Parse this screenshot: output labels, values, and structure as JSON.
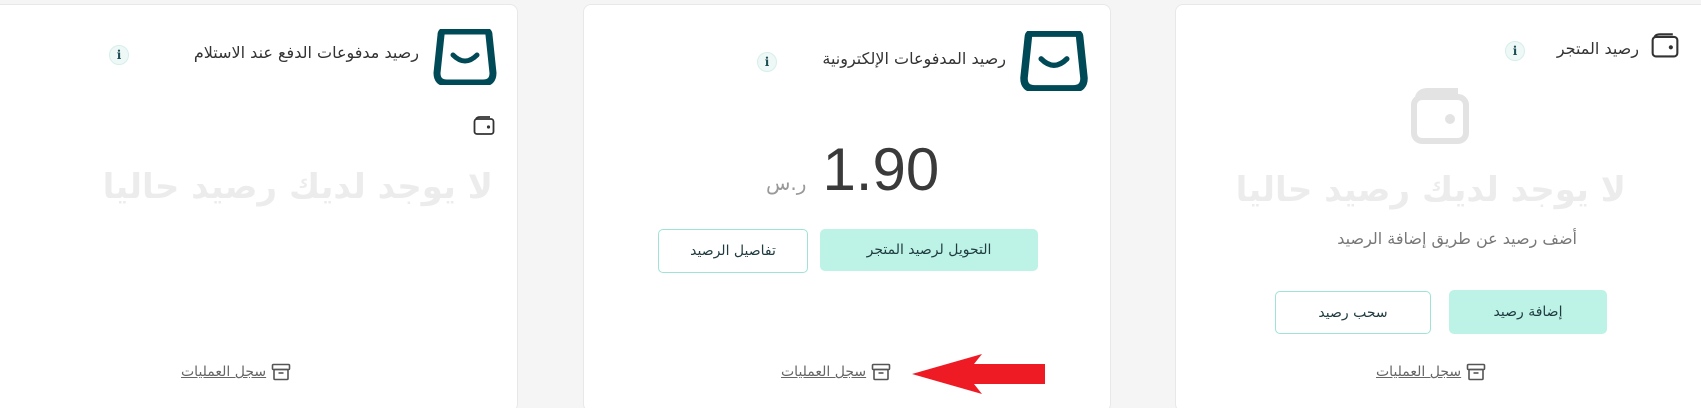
{
  "cards": {
    "cod": {
      "title": "رصيد مدفوعات الدفع عند الاستلام",
      "info": "i",
      "empty": "لا يوجد لديك رصيد حاليا",
      "log": "سجل العمليات"
    },
    "epay": {
      "title": "رصيد المدفوعات الإلكترونية",
      "info": "i",
      "amount": "1.90",
      "currency": "ر.س",
      "transfer_button": "التحويل لرصيد المتجر",
      "details_button": "تفاصيل الرصيد",
      "log": "سجل العمليات"
    },
    "store": {
      "title": "رصيد المتجر",
      "info": "i",
      "empty": "لا يوجد لديك رصيد حاليا",
      "hint": "أضف رصيد عن طريق إضافة الرصيد",
      "add_button": "إضافة رصيد",
      "withdraw_button": "سحب رصيد",
      "log": "سجل العمليات"
    }
  },
  "colors": {
    "brand": "#004956",
    "accent": "#bdf2e6",
    "arrow": "#ee1b24"
  },
  "icons": [
    "bag-logo-icon",
    "info-icon",
    "wallet-icon",
    "archive-box-icon",
    "red-arrow-icon"
  ]
}
